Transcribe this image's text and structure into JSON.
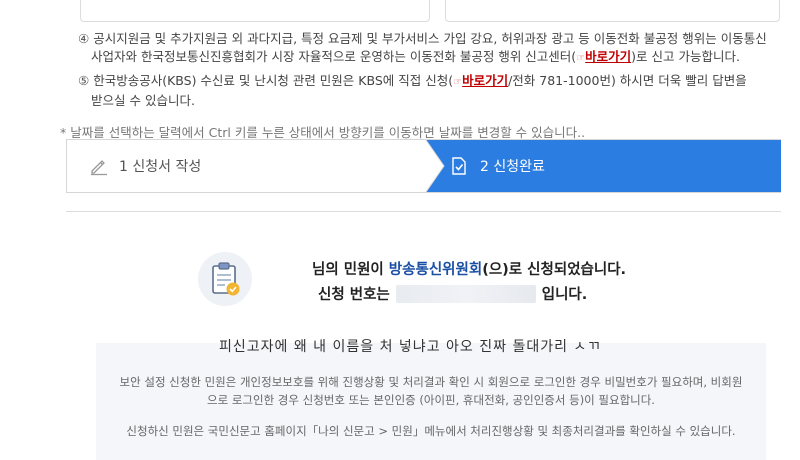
{
  "notices": [
    {
      "num": "④",
      "line1": "공시지원금 및 추가지원금 외 과다지급, 특정 요금제 및 부가서비스 가입 강요, 허위과장 광고 등 이동전화 불공정 행위는 이동통신",
      "line2_pre": "사업자와 한국정보통신진흥협회가 시장 자율적으로 운영하는 이동전화 불공정 행위 신고센터(",
      "link": "바로가기",
      "line2_post": ")로 신고 가능합니다."
    },
    {
      "num": "⑤",
      "line1_pre": "한국방송공사(KBS) 수신료 및 난시청 관련 민원은 KBS에 직접 신청(",
      "link": "바로가기",
      "line1_post": "/전화 781-1000번) 하시면 더욱 빨리 답변을",
      "line2": "받으실 수 있습니다."
    }
  ],
  "date_hint": "* 날짜를 선택하는 달력에서 Ctrl 키를 누른 상태에서 방향키를 이동하면 날짜를 변경할 수 있습니다..",
  "steps": [
    {
      "label": "1 신청서 작성",
      "icon": "pencil-icon",
      "active": false
    },
    {
      "label": "2 신청완료",
      "icon": "document-check-icon",
      "active": true
    }
  ],
  "result": {
    "line1_pre": "님의 민원이 ",
    "org": "방송통신위원회",
    "line1_post": "(으)로 신청되었습니다.",
    "line2_pre": "신청 번호는",
    "line2_post": "입니다."
  },
  "wording_text": "피신고자에 왜 내 이름을 처 넣냐고 아오 진짜 돌대가리 ㅅㄲ",
  "info": {
    "p1": "보안 설정 신청한 민원은 개인정보보호를 위해 진행상황 및 처리결과 확인 시 회원으로 로그인한 경우 비밀번호가 필요하며, 비회원으로 로그인한 경우 신청번호 또는 본인인증 (아이핀, 휴대전화, 공인인증서 등)이 필요합니다.",
    "p2": "신청하신 민원은 국민신문고 홈페이지「나의 신문고 > 민원」메뉴에서 처리진행상황 및 최종처리결과를 확인하실 수 있습니다."
  },
  "colors": {
    "accent_blue": "#2b7de1",
    "link_red": "#c00000",
    "org_blue": "#1a4fa3"
  }
}
